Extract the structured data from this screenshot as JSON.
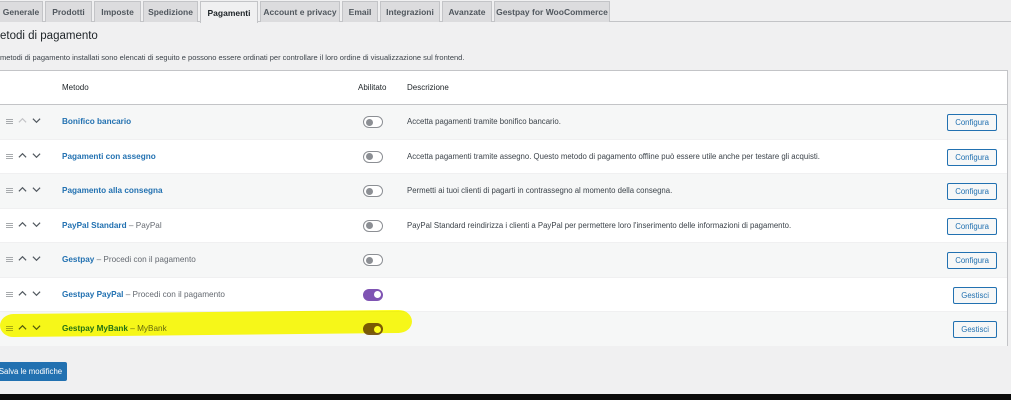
{
  "tabs": [
    {
      "label": "Generale",
      "active": false
    },
    {
      "label": "Prodotti",
      "active": false
    },
    {
      "label": "Imposte",
      "active": false
    },
    {
      "label": "Spedizione",
      "active": false
    },
    {
      "label": "Pagamenti",
      "active": true
    },
    {
      "label": "Account e privacy",
      "active": false
    },
    {
      "label": "Email",
      "active": false
    },
    {
      "label": "Integrazioni",
      "active": false
    },
    {
      "label": "Avanzate",
      "active": false
    },
    {
      "label": "Gestpay for WooCommerce",
      "active": false
    }
  ],
  "section": {
    "title": "etodi di pagamento",
    "description": "metodi di pagamento installati sono elencati di seguito e possono essere ordinati per controllare il loro ordine di visualizzazione sul frontend."
  },
  "table": {
    "headers": {
      "method": "Metodo",
      "enabled": "Abilitato",
      "description": "Descrizione"
    },
    "rows": [
      {
        "name": "Bonifico bancario",
        "subtitle": "",
        "enabled": false,
        "description": "Accetta pagamenti tramite bonifico bancario.",
        "action": "Configura"
      },
      {
        "name": "Pagamenti con assegno",
        "subtitle": "",
        "enabled": false,
        "description": "Accetta pagamenti tramite assegno. Questo metodo di pagamento offline può essere utile anche per testare gli acquisti.",
        "action": "Configura"
      },
      {
        "name": "Pagamento alla consegna",
        "subtitle": "",
        "enabled": false,
        "description": "Permetti ai tuoi clienti di pagarti in contrassegno al momento della consegna.",
        "action": "Configura"
      },
      {
        "name": "PayPal Standard",
        "subtitle": " – PayPal",
        "enabled": false,
        "description": "PayPal Standard reindirizza i clienti a PayPal per permettere loro l'inserimento delle informazioni di pagamento.",
        "action": "Configura"
      },
      {
        "name": "Gestpay",
        "subtitle": " – Procedi con il pagamento",
        "enabled": false,
        "description": "",
        "action": "Configura"
      },
      {
        "name": "Gestpay PayPal",
        "subtitle": " – Procedi con il pagamento",
        "enabled": true,
        "description": "",
        "action": "Gestisci"
      },
      {
        "name": "Gestpay MyBank",
        "subtitle": " – MyBank",
        "enabled": true,
        "description": "",
        "action": "Gestisci"
      }
    ]
  },
  "save_label": "Salva le modifiche",
  "colors": {
    "accent": "#2271b1",
    "toggle_on": "#7f54b3",
    "highlight": "#ffff00"
  }
}
